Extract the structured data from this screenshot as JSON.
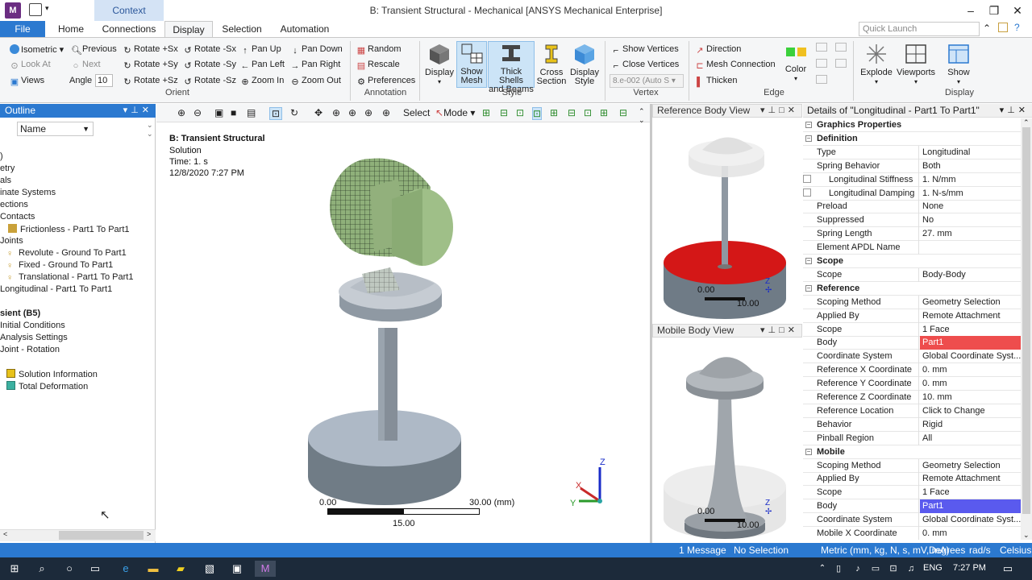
{
  "app": {
    "title": "B: Transient Structural - Mechanical [ANSYS Mechanical Enterprise]",
    "icon": "M",
    "context_tab": "Context",
    "quick_launch_placeholder": "Quick Launch"
  },
  "tabs": [
    "File",
    "Home",
    "Connections",
    "Display",
    "Selection",
    "Automation"
  ],
  "ribbon": {
    "orient": {
      "label": "Orient",
      "isometric": "Isometric",
      "previous": "Previous",
      "look_at": "Look At",
      "next": "Next",
      "views": "Views",
      "angle_label": "Angle",
      "angle_value": "10",
      "rot_px": "Rotate +Sx",
      "rot_py": "Rotate +Sy",
      "rot_pz": "Rotate +Sz",
      "rot_mx": "Rotate -Sx",
      "rot_my": "Rotate -Sy",
      "rot_mz": "Rotate -Sz",
      "pan_up": "Pan Up",
      "pan_left": "Pan Left",
      "zoom_in": "Zoom In",
      "pan_down": "Pan Down",
      "pan_right": "Pan Right",
      "zoom_out": "Zoom Out"
    },
    "annotation": {
      "label": "Annotation",
      "random": "Random",
      "rescale": "Rescale",
      "preferences": "Preferences"
    },
    "style": {
      "label": "Style",
      "display": "Display",
      "show_mesh_1": "Show",
      "show_mesh_2": "Mesh",
      "thick_1": "Thick Shells",
      "thick_2": "and Beams",
      "cross_1": "Cross",
      "cross_2": "Section",
      "dstyle_1": "Display",
      "dstyle_2": "Style"
    },
    "vertex": {
      "label": "Vertex",
      "show_vertices": "Show Vertices",
      "close_vertices": "Close Vertices",
      "tolerance": "8.e-002 (Auto S"
    },
    "edge": {
      "label": "Edge",
      "direction": "Direction",
      "mesh_connection": "Mesh Connection",
      "thicken": "Thicken",
      "color": "Color"
    },
    "display": {
      "label": "Display",
      "explode": "Explode",
      "viewports": "Viewports",
      "show": "Show"
    }
  },
  "outline": {
    "title": "Outline",
    "name_filter": "Name",
    "items": [
      ")",
      "etry",
      "als",
      "inate Systems",
      "ections",
      "Contacts",
      "Frictionless - Part1 To Part1",
      "Joints",
      "Revolute - Ground To Part1",
      "Fixed - Ground To Part1",
      "Translational - Part1 To Part1",
      "Longitudinal - Part1 To Part1",
      "sient (B5)",
      "Initial Conditions",
      "Analysis Settings",
      "Joint - Rotation",
      "Solution Information",
      "Total Deformation"
    ]
  },
  "graphics": {
    "select": "Select",
    "mode": "Mode",
    "info_title": "B: Transient Structural",
    "info_type": "Solution",
    "info_time": "Time: 1. s",
    "info_date": "12/8/2020 7:27 PM",
    "scale_min": "0.00",
    "scale_max": "30.00 (mm)",
    "scale_mid": "15.00",
    "axis_x": "X",
    "axis_y": "Y",
    "axis_z": "Z"
  },
  "reference_view": {
    "title": "Reference Body View",
    "scale_min": "0.00",
    "scale_mid": "10.00"
  },
  "mobile_view": {
    "title": "Mobile Body View",
    "scale_min": "0.00",
    "scale_mid": "10.00"
  },
  "details": {
    "title": "Details of \"Longitudinal - Part1 To Part1\"",
    "rows": [
      {
        "sec": true,
        "k": "Graphics Properties"
      },
      {
        "sec": true,
        "k": "Definition"
      },
      {
        "k": "Type",
        "v": "Longitudinal"
      },
      {
        "k": "Spring Behavior",
        "v": "Both"
      },
      {
        "k": "Longitudinal Stiffness",
        "v": "1. N/mm",
        "cb": true
      },
      {
        "k": "Longitudinal Damping",
        "v": "1. N-s/mm",
        "cb": true
      },
      {
        "k": "Preload",
        "v": "None"
      },
      {
        "k": "Suppressed",
        "v": "No"
      },
      {
        "k": "Spring Length",
        "v": "27. mm"
      },
      {
        "k": "Element APDL Name",
        "v": ""
      },
      {
        "sec": true,
        "k": "Scope"
      },
      {
        "k": "Scope",
        "v": "Body-Body"
      },
      {
        "sec": true,
        "k": "Reference"
      },
      {
        "k": "Scoping Method",
        "v": "Geometry Selection"
      },
      {
        "k": "Applied By",
        "v": "Remote Attachment"
      },
      {
        "k": "Scope",
        "v": "1 Face"
      },
      {
        "k": "Body",
        "v": "Part1",
        "hl": "#ee4d4d"
      },
      {
        "k": "Coordinate System",
        "v": "Global Coordinate Syst..."
      },
      {
        "k": "Reference X Coordinate",
        "v": "0. mm"
      },
      {
        "k": "Reference Y Coordinate",
        "v": "0. mm"
      },
      {
        "k": "Reference Z Coordinate",
        "v": "10. mm"
      },
      {
        "k": "Reference Location",
        "v": "Click to Change"
      },
      {
        "k": "Behavior",
        "v": "Rigid"
      },
      {
        "k": "Pinball Region",
        "v": "All"
      },
      {
        "sec": true,
        "k": "Mobile"
      },
      {
        "k": "Scoping Method",
        "v": "Geometry Selection"
      },
      {
        "k": "Applied By",
        "v": "Remote Attachment"
      },
      {
        "k": "Scope",
        "v": "1 Face"
      },
      {
        "k": "Body",
        "v": "Part1",
        "hl": "#5a5aee"
      },
      {
        "k": "Coordinate System",
        "v": "Global Coordinate Syst..."
      },
      {
        "k": "Mobile X Coordinate",
        "v": "0. mm"
      }
    ]
  },
  "status": {
    "messages": "1 Message",
    "selection": "No Selection",
    "units": "Metric (mm, kg, N, s, mV, mA)",
    "angle": "Degrees",
    "rot": "rad/s",
    "temp": "Celsius"
  },
  "taskbar": {
    "lang": "ENG",
    "time": "7:27 PM"
  }
}
